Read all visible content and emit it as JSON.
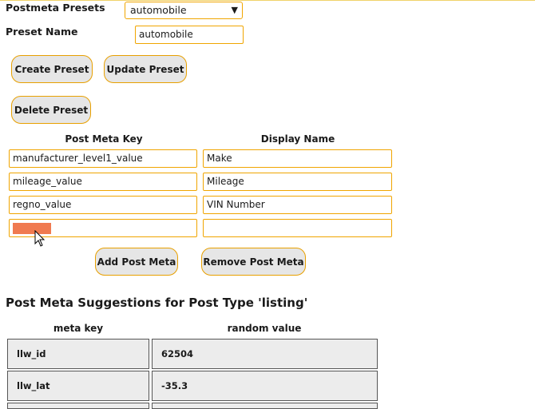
{
  "presets": {
    "postmeta_presets_label": "Postmeta Presets",
    "selected_preset": "automobile",
    "preset_name_label": "Preset Name",
    "preset_name_value": "automobile",
    "create_label": "Create Preset",
    "update_label": "Update Preset",
    "delete_label": "Delete Preset"
  },
  "meta_table": {
    "key_header": "Post Meta Key",
    "display_header": "Display Name",
    "rows": [
      {
        "key": "manufacturer_level1_value",
        "display": "Make"
      },
      {
        "key": "mileage_value",
        "display": "Mileage"
      },
      {
        "key": "regno_value",
        "display": "VIN Number"
      },
      {
        "key": "",
        "display": ""
      }
    ],
    "add_label": "Add Post Meta",
    "remove_label": "Remove Post Meta"
  },
  "suggestions": {
    "title": "Post Meta Suggestions for Post Type 'listing'",
    "col_key": "meta key",
    "col_value": "random value",
    "rows": [
      {
        "key": "llw_id",
        "value": "62504"
      },
      {
        "key": "llw_lat",
        "value": "-35.3"
      },
      {
        "key": "",
        "value": ""
      }
    ]
  },
  "icons": {
    "dropdown": "caret-down-icon",
    "cursor": "mouse-pointer-icon"
  },
  "colors": {
    "accent_border": "#f0a500",
    "button_bg": "#e6e6e6",
    "selection": "#f07a50"
  }
}
